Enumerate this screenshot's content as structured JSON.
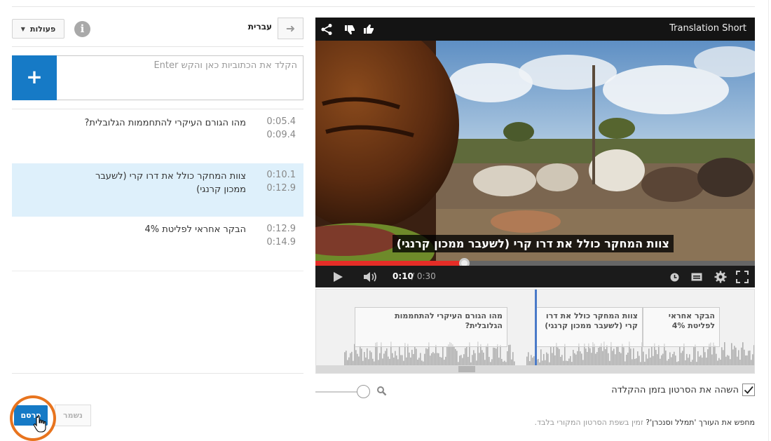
{
  "header": {
    "language": "עברית",
    "back_arrow": "➜",
    "actions_label": "פעולות",
    "info_glyph": "i"
  },
  "editor": {
    "input_placeholder": "הקלד את הכתוביות כאן והקש Enter",
    "add_glyph": "+",
    "captions": [
      {
        "start": "0:05.4",
        "end": "0:09.4",
        "text": "מהו הגורם העיקרי להתחממות הגלובלית?"
      },
      {
        "start": "0:10.1",
        "end": "0:12.9",
        "text": "צוות המחקר כולל את דרו קרי (לשעבר ממכון קרנגי)"
      },
      {
        "start": "0:12.9",
        "end": "0:14.9",
        "text": "הבקר אחראי לפליטת 4%"
      }
    ],
    "selected_index": 1
  },
  "footer_buttons": {
    "saved_label": "נשמר",
    "publish_label": "פרסם"
  },
  "video": {
    "title": "Translation Short",
    "subtitle": "צוות המחקר כולל את דרו קרי (לשעבר ממכון קרנגי)",
    "time_current": "0:10",
    "time_total": "/ 0:30",
    "progress": 0.34
  },
  "timeline": {
    "blocks": [
      {
        "text": "מהו הגורם העיקרי להתחממות הגלובלית?"
      },
      {
        "text": "צוות המחקר כולל את דרו קרי (לשעבר ממכון קרנגי)"
      },
      {
        "text": "הבקר אחראי לפליטת 4%"
      }
    ]
  },
  "options": {
    "pause_while_typing_label": "השהה את הסרטון בזמן ההקלדה",
    "pause_while_typing_checked": true,
    "footer_question": "מחפש את העורך 'תמלל וסנכרן'?",
    "footer_answer": "זמין בשפת הסרטון המקורי בלבד."
  },
  "colors": {
    "accent": "#167ac6",
    "selected_row": "#def0fb",
    "progress_red": "#e52d27",
    "ring_orange": "#e8741e"
  },
  "icons": [
    "share-icon",
    "dislike-icon",
    "like-icon",
    "play-icon",
    "volume-icon",
    "watch-later-icon",
    "captions-icon",
    "settings-icon",
    "fullscreen-icon",
    "zoom-icon",
    "check-icon",
    "hand-cursor-icon"
  ]
}
